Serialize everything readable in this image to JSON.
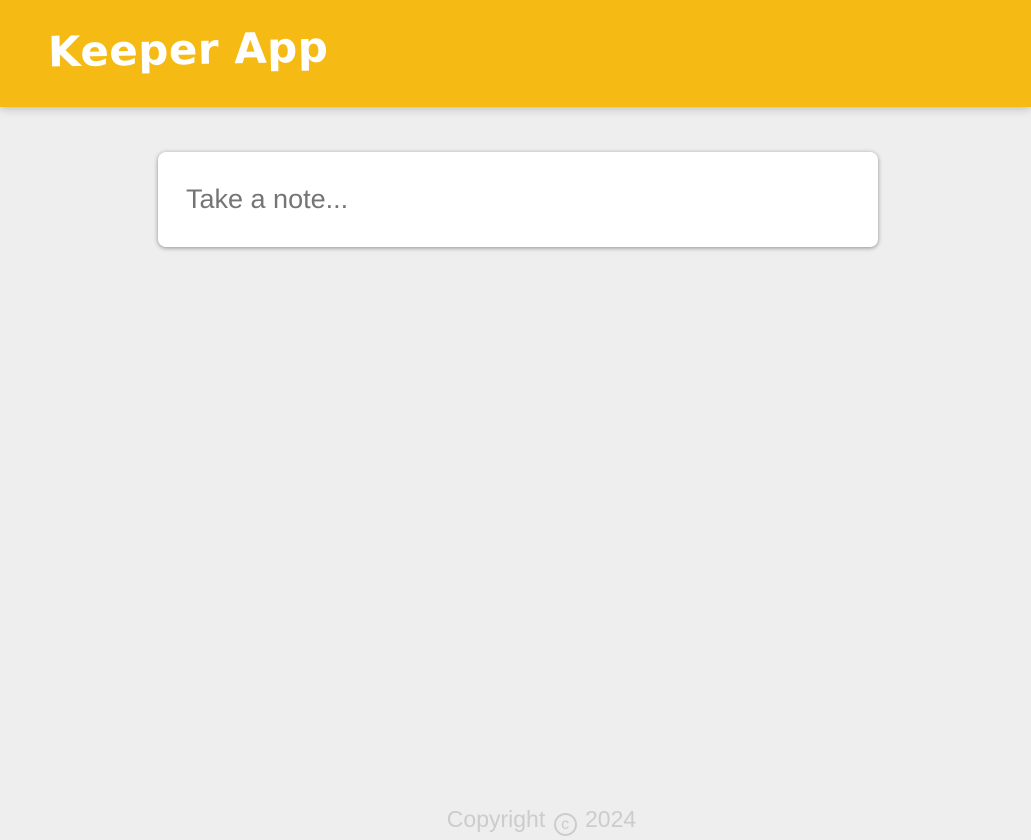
{
  "header": {
    "title": "Keeper App",
    "background_color": "#f5ba13"
  },
  "note_form": {
    "input_value": "",
    "placeholder": "Take a note..."
  },
  "footer": {
    "prefix": "Copyright",
    "icon": "copyright-icon",
    "icon_glyph": "c",
    "year": "2024"
  }
}
